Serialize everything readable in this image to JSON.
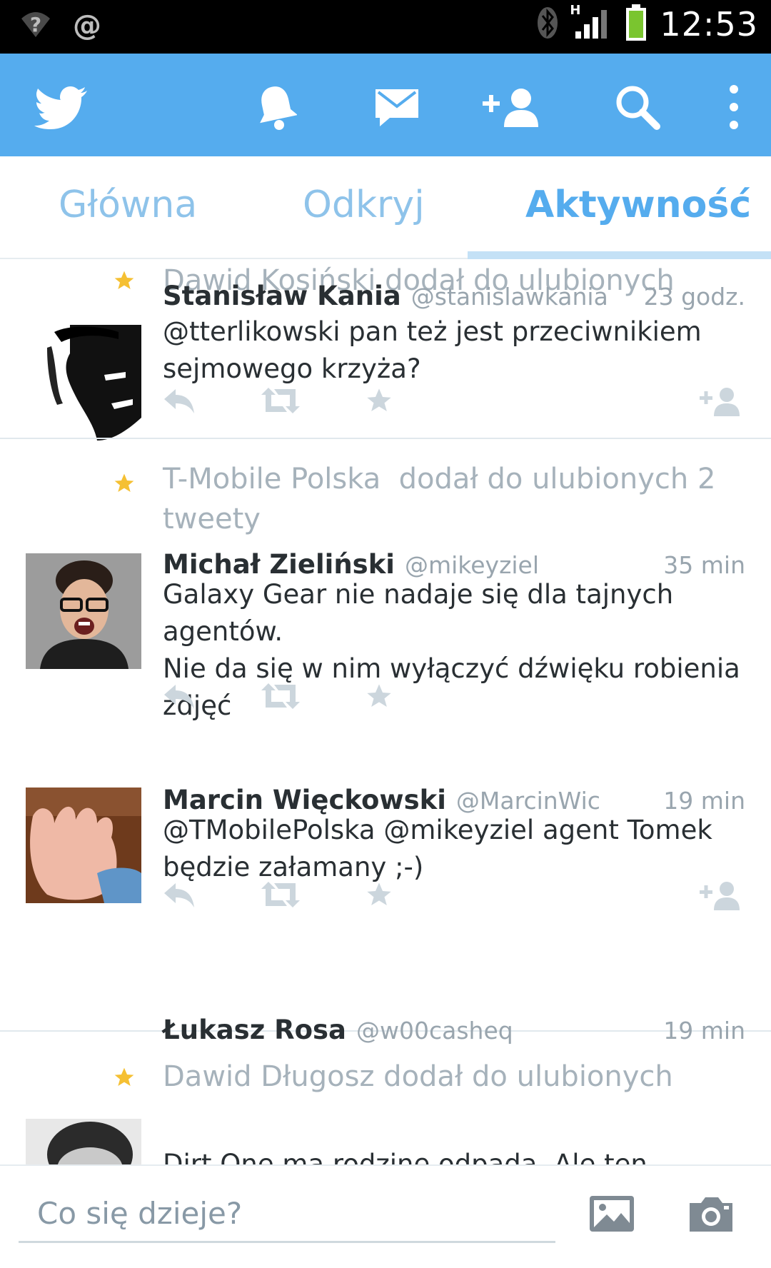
{
  "status_bar": {
    "time": "12:53",
    "network": "H",
    "left_icons": [
      "wifi-question-icon",
      "at-icon"
    ],
    "right_icons": [
      "bluetooth-icon",
      "signal-icon",
      "battery-icon"
    ],
    "at_symbol": "@"
  },
  "action_bar": {
    "color": "#55acee",
    "icons": [
      "twitter-bird-icon",
      "bell-icon",
      "envelope-icon",
      "add-user-icon",
      "search-icon",
      "overflow-menu-icon"
    ]
  },
  "tabs": [
    {
      "label": "Główna",
      "active": false
    },
    {
      "label": "Odkryj",
      "active": false
    },
    {
      "label": "Aktywność",
      "active": true
    }
  ],
  "feed": [
    {
      "activity": "Dawid Kosiński dodał do ulubionych",
      "tweets": [
        {
          "name": "Stanisław Kania",
          "handle": "@stanislawkania",
          "time": "23 godz.",
          "text_lines": [
            "@tterlikowski pan też jest przeciwnikiem",
            "sejmowego krzyża?"
          ],
          "show_follow": true
        }
      ]
    },
    {
      "activity_lines": [
        "T-Mobile Polska  dodał do ulubionych 2",
        "tweety"
      ],
      "tweets": [
        {
          "name": "Michał Zieliński",
          "handle": "@mikeyziel",
          "time": "35 min",
          "text_lines": [
            "Galaxy Gear nie nadaje się dla tajnych agentów.",
            "Nie da się w nim wyłączyć dźwięku robienia",
            "zdjęć"
          ],
          "show_follow": false
        },
        {
          "name": "Marcin Więckowski",
          "handle": "@MarcinWic",
          "time": "19 min",
          "text_lines": [
            "@TMobilePolska @mikeyziel agent Tomek",
            "będzie załamany ;-)"
          ],
          "show_follow": true
        }
      ]
    },
    {
      "activity": "Dawid Długosz dodał do ulubionych",
      "tweets": [
        {
          "name": "Łukasz Rosa",
          "handle": "@w00casheq",
          "time": "19 min",
          "text_lines": [
            "Dirt One ma rodzinę odpada. Ale ten"
          ],
          "show_follow": false
        }
      ]
    }
  ],
  "compose": {
    "placeholder": "Co się dzieje?",
    "icons": [
      "image-icon",
      "camera-icon"
    ]
  }
}
